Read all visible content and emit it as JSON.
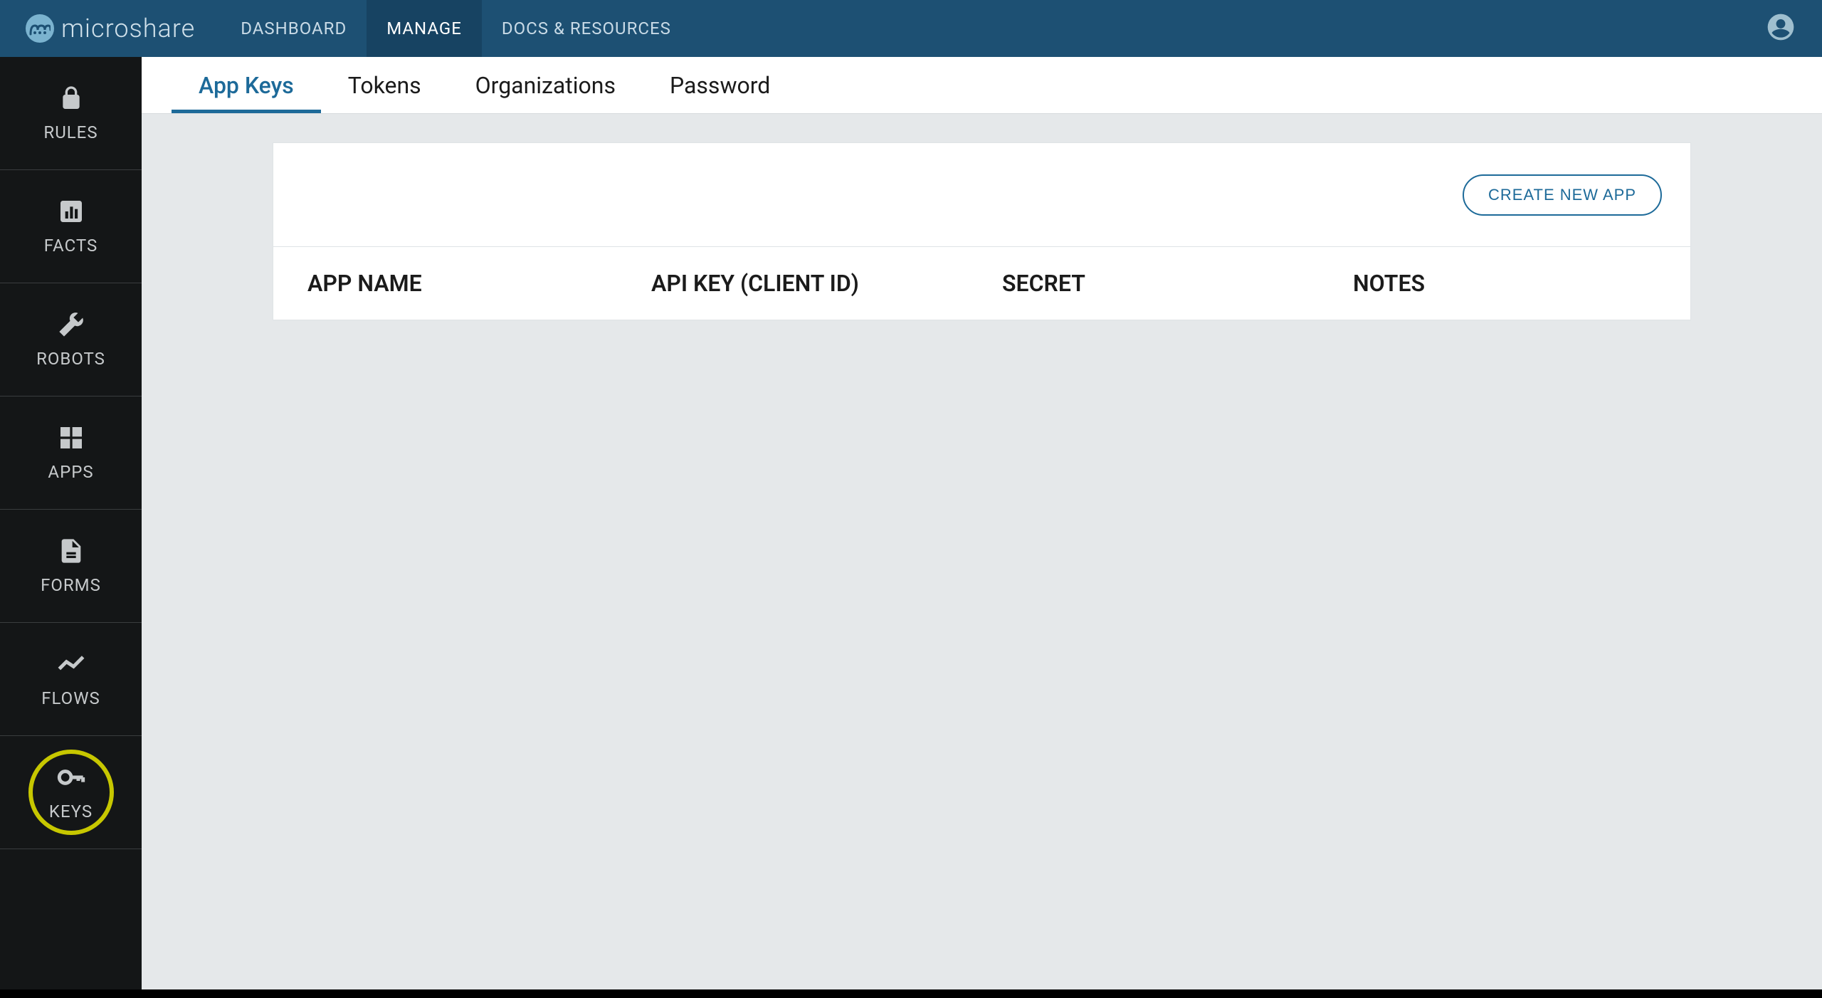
{
  "brand": {
    "name": "microshare"
  },
  "topnav": {
    "items": [
      {
        "label": "DASHBOARD",
        "active": false
      },
      {
        "label": "MANAGE",
        "active": true
      },
      {
        "label": "DOCS & RESOURCES",
        "active": false
      }
    ]
  },
  "sidebar": {
    "items": [
      {
        "icon": "lock-icon",
        "label": "RULES"
      },
      {
        "icon": "bar-chart-icon",
        "label": "FACTS"
      },
      {
        "icon": "wrench-icon",
        "label": "ROBOTS"
      },
      {
        "icon": "apps-grid-icon",
        "label": "APPS"
      },
      {
        "icon": "file-icon",
        "label": "FORMS"
      },
      {
        "icon": "trend-icon",
        "label": "FLOWS"
      },
      {
        "icon": "key-icon",
        "label": "KEYS",
        "highlighted": true
      }
    ]
  },
  "tabs": {
    "items": [
      {
        "label": "App Keys",
        "active": true
      },
      {
        "label": "Tokens",
        "active": false
      },
      {
        "label": "Organizations",
        "active": false
      },
      {
        "label": "Password",
        "active": false
      }
    ]
  },
  "actions": {
    "create_new_app": "CREATE NEW APP"
  },
  "table": {
    "columns": [
      {
        "label": "APP NAME"
      },
      {
        "label": "API KEY (CLIENT ID)"
      },
      {
        "label": "SECRET"
      },
      {
        "label": "NOTES"
      }
    ],
    "rows": []
  }
}
